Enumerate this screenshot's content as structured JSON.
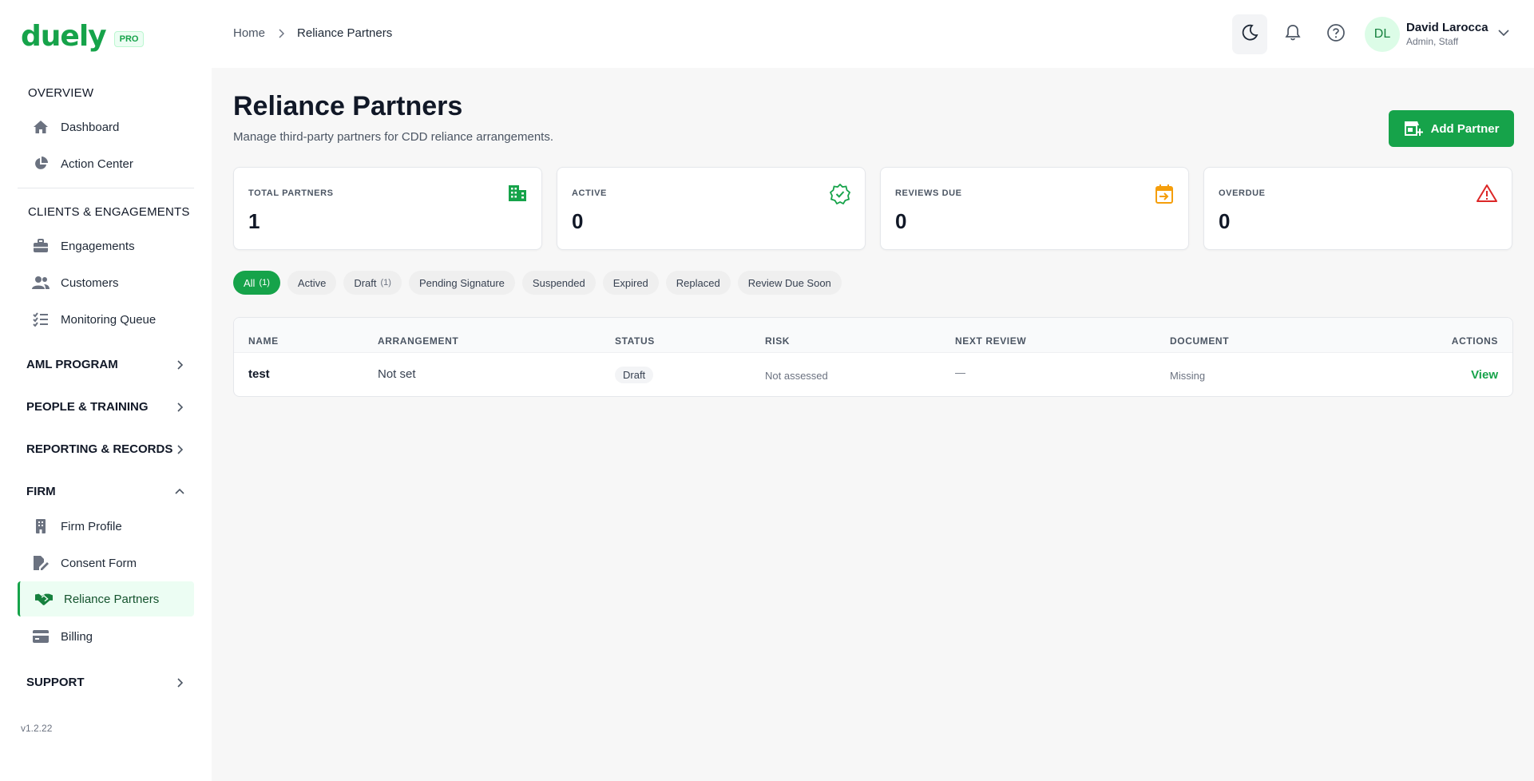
{
  "brand": {
    "name": "duely",
    "badge": "PRO",
    "color": "#16a34a"
  },
  "sidebar": {
    "overview_label": "OVERVIEW",
    "overview_items": [
      {
        "label": "Dashboard",
        "icon": "home-icon"
      },
      {
        "label": "Action Center",
        "icon": "pie-chart-icon"
      }
    ],
    "clients_label": "CLIENTS & ENGAGEMENTS",
    "clients_items": [
      {
        "label": "Engagements",
        "icon": "briefcase-icon"
      },
      {
        "label": "Customers",
        "icon": "users-icon"
      },
      {
        "label": "Monitoring Queue",
        "icon": "checklist-icon"
      }
    ],
    "groups": [
      {
        "label": "AML PROGRAM",
        "expanded": false
      },
      {
        "label": "PEOPLE & TRAINING",
        "expanded": false
      },
      {
        "label": "REPORTING & RECORDS",
        "expanded": false
      },
      {
        "label": "FIRM",
        "expanded": true
      },
      {
        "label": "SUPPORT",
        "expanded": false
      }
    ],
    "firm_items": [
      {
        "label": "Firm Profile",
        "icon": "building-icon"
      },
      {
        "label": "Consent Form",
        "icon": "document-sign-icon"
      },
      {
        "label": "Reliance Partners",
        "icon": "handshake-icon",
        "active": true
      },
      {
        "label": "Billing",
        "icon": "credit-card-icon"
      }
    ],
    "version": "v1.2.22"
  },
  "topbar": {
    "breadcrumb": {
      "home": "Home",
      "current": "Reliance Partners"
    },
    "user": {
      "initials": "DL",
      "name": "David Larocca",
      "role": "Admin, Staff"
    }
  },
  "page": {
    "title": "Reliance Partners",
    "subtitle": "Manage third-party partners for CDD reliance arrangements.",
    "add_button": "Add Partner"
  },
  "stats": [
    {
      "label": "TOTAL PARTNERS",
      "value": "1",
      "icon": "building-icon",
      "color": "#16a34a"
    },
    {
      "label": "ACTIVE",
      "value": "0",
      "icon": "badge-check-icon",
      "color": "#16a34a"
    },
    {
      "label": "REVIEWS DUE",
      "value": "0",
      "icon": "calendar-arrow-icon",
      "color": "#f59e0b"
    },
    {
      "label": "OVERDUE",
      "value": "0",
      "icon": "warning-icon",
      "color": "#dc2626"
    }
  ],
  "filters": [
    {
      "label": "All",
      "count": "(1)",
      "active": true
    },
    {
      "label": "Active",
      "count": ""
    },
    {
      "label": "Draft",
      "count": "(1)"
    },
    {
      "label": "Pending Signature",
      "count": ""
    },
    {
      "label": "Suspended",
      "count": ""
    },
    {
      "label": "Expired",
      "count": ""
    },
    {
      "label": "Replaced",
      "count": ""
    },
    {
      "label": "Review Due Soon",
      "count": ""
    }
  ],
  "table": {
    "columns": [
      "NAME",
      "ARRANGEMENT",
      "STATUS",
      "RISK",
      "NEXT REVIEW",
      "DOCUMENT",
      "ACTIONS"
    ],
    "rows": [
      {
        "name": "test",
        "arrangement": "Not set",
        "status": "Draft",
        "risk": "Not assessed",
        "next_review": "—",
        "document": "Missing",
        "action": "View"
      }
    ]
  }
}
